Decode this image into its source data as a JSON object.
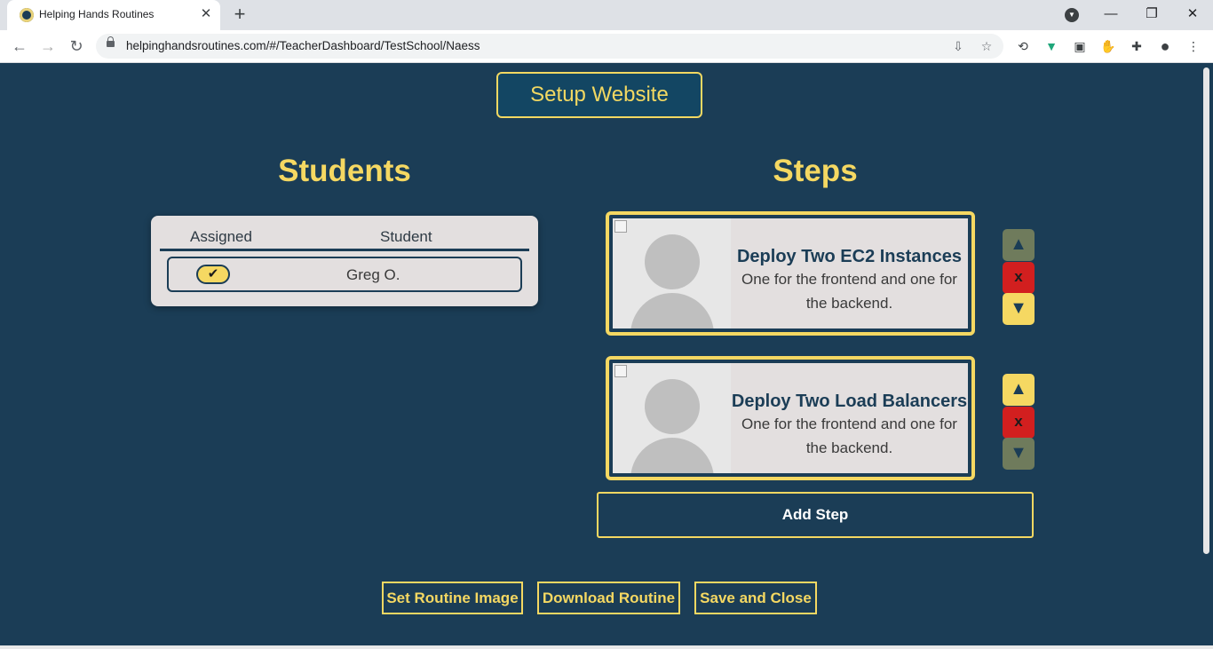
{
  "browser": {
    "tab_title": "Helping Hands Routines",
    "tab_close": "✕",
    "new_tab": "+",
    "url": "helpinghandsroutines.com/#/TeacherDashboard/TestSchool/Naess",
    "window_controls": {
      "minimize": "—",
      "restore": "❐",
      "close": "✕"
    },
    "nav": {
      "back": "←",
      "forward": "→",
      "reload": "↻"
    }
  },
  "header": {
    "setup_label": "Setup Website"
  },
  "students": {
    "heading": "Students",
    "columns": {
      "assigned": "Assigned",
      "student": "Student"
    },
    "rows": [
      {
        "assigned": true,
        "check_glyph": "✔",
        "name": "Greg O."
      }
    ]
  },
  "steps": {
    "heading": "Steps",
    "items": [
      {
        "title": "Deploy Two EC2 Instances",
        "description": "One for the frontend and one for the backend.",
        "up_enabled": false,
        "down_enabled": true
      },
      {
        "title": "Deploy Two Load Balancers",
        "description": "One for the frontend and one for the backend.",
        "up_enabled": true,
        "down_enabled": false
      }
    ],
    "controls": {
      "up": "▲",
      "delete": "x",
      "down": "▼"
    },
    "add_label": "Add Step"
  },
  "footer": {
    "set_image_label": "Set Routine Image",
    "download_label": "Download Routine",
    "save_close_label": "Save and Close"
  },
  "colors": {
    "page_bg": "#1b3d56",
    "accent_yellow": "#f5d862",
    "card_bg": "#e3dfdf",
    "delete_red": "#d21f1f",
    "disabled_olive": "#6f7b5c"
  }
}
